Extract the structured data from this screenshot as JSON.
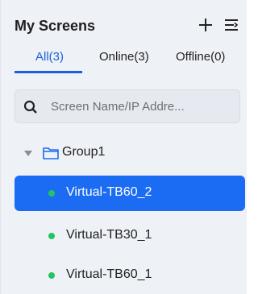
{
  "header": {
    "title": "My Screens",
    "add_icon": "plus-icon",
    "menu_icon": "list-filter-icon"
  },
  "tabs": [
    {
      "label": "All(3)",
      "active": true
    },
    {
      "label": "Online(3)",
      "active": false
    },
    {
      "label": "Offline(0)",
      "active": false
    }
  ],
  "search": {
    "placeholder": "Screen Name/IP Addre...",
    "value": "",
    "icon": "search-icon"
  },
  "group": {
    "label": "Group1",
    "expanded": true,
    "icon": "folder-icon"
  },
  "screens": [
    {
      "name": "Virtual-TB60_2",
      "status": "online",
      "selected": true
    },
    {
      "name": "Virtual-TB30_1",
      "status": "online",
      "selected": false
    },
    {
      "name": "Virtual-TB60_1",
      "status": "online",
      "selected": false
    }
  ],
  "colors": {
    "accent": "#1b6cf2",
    "online": "#22c55e",
    "panel_bg": "#eef1f6"
  }
}
